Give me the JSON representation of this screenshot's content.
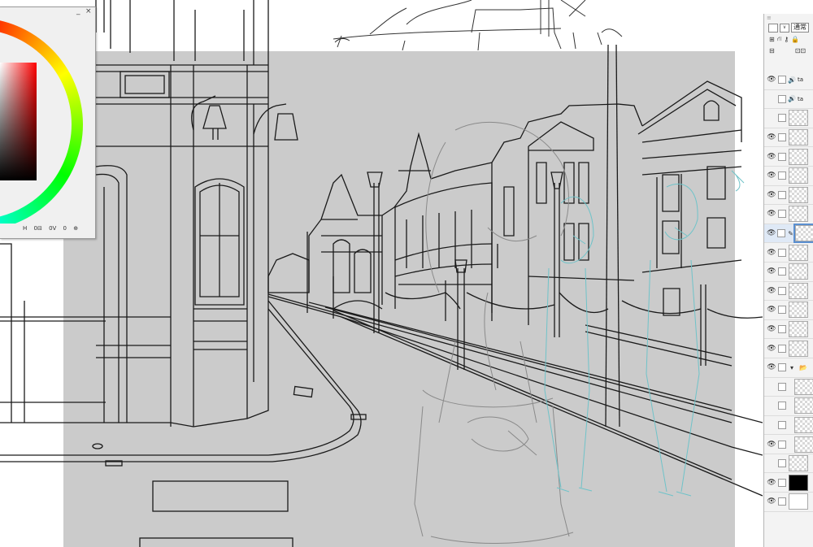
{
  "color_panel": {
    "minimize": "_",
    "close": "×",
    "footer_icons": [
      "H",
      "0⊟",
      "0V",
      "0",
      "⊕"
    ]
  },
  "layer_panel": {
    "grip": "≡",
    "blend_mode": "通常",
    "blend_chevron": "∨",
    "tools": [
      "⊞",
      "⛙",
      "⚷",
      "🔒"
    ],
    "tools_row2": [
      "⊟",
      "⊡⊡"
    ],
    "layers": [
      {
        "eye": true,
        "icon": "🔊",
        "name": "ta",
        "type": "audio"
      },
      {
        "eye": false,
        "icon": "🔊",
        "name": "ta",
        "type": "audio"
      },
      {
        "eye": false,
        "type": "raster"
      },
      {
        "eye": true,
        "type": "raster"
      },
      {
        "eye": true,
        "type": "raster"
      },
      {
        "eye": true,
        "type": "raster"
      },
      {
        "eye": true,
        "type": "raster"
      },
      {
        "eye": true,
        "type": "raster"
      },
      {
        "eye": true,
        "icon": "✎",
        "type": "raster",
        "selected": true
      },
      {
        "eye": true,
        "type": "raster"
      },
      {
        "eye": true,
        "type": "raster"
      },
      {
        "eye": true,
        "type": "raster"
      },
      {
        "eye": true,
        "type": "raster"
      },
      {
        "eye": true,
        "type": "raster"
      },
      {
        "eye": true,
        "type": "raster"
      },
      {
        "eye": true,
        "type": "folder",
        "icon": "▾"
      },
      {
        "eye": false,
        "type": "raster",
        "indent": true
      },
      {
        "eye": false,
        "type": "raster",
        "indent": true
      },
      {
        "eye": false,
        "type": "raster",
        "indent": true
      },
      {
        "eye": true,
        "type": "raster",
        "indent": true
      },
      {
        "eye": false,
        "type": "raster"
      },
      {
        "eye": true,
        "type": "black"
      },
      {
        "eye": true,
        "type": "white"
      }
    ]
  },
  "colors": {
    "canvas_gray": "#cbcbcb",
    "line": "#1a1a1a",
    "sketch_gray": "#8a8a8a",
    "sketch_teal": "#6fc3c9"
  }
}
